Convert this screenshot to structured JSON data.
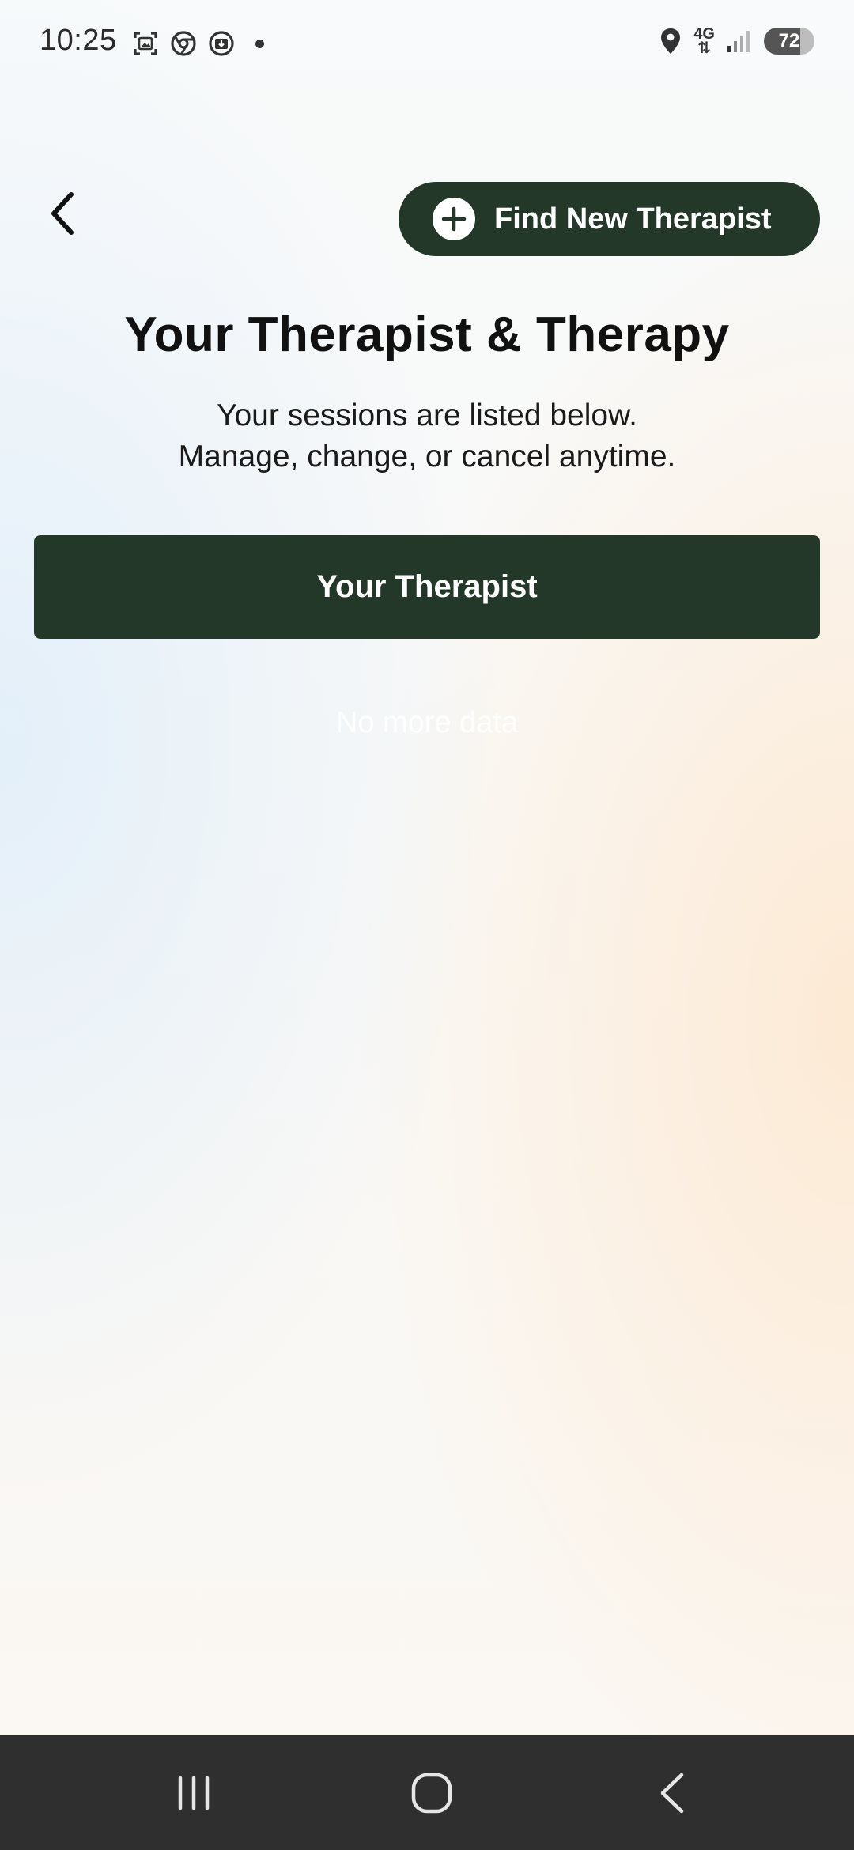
{
  "status_bar": {
    "time": "10:25",
    "network": "4G",
    "battery": "72"
  },
  "header": {
    "find_new_therapist_label": "Find New Therapist"
  },
  "page": {
    "title": "Your Therapist & Therapy",
    "subtitle_line1": "Your sessions are listed below.",
    "subtitle_line2": "Manage, change, or cancel anytime."
  },
  "tab": {
    "label": "Your Therapist"
  },
  "list": {
    "empty_text": "No more data"
  },
  "colors": {
    "primary": "#243829",
    "nav_bar": "#2f2f2f"
  },
  "icons": {
    "back": "chevron-left-icon",
    "add": "plus-circle-icon",
    "nav_recents": "recents-icon",
    "nav_home": "home-icon",
    "nav_back": "back-icon"
  }
}
